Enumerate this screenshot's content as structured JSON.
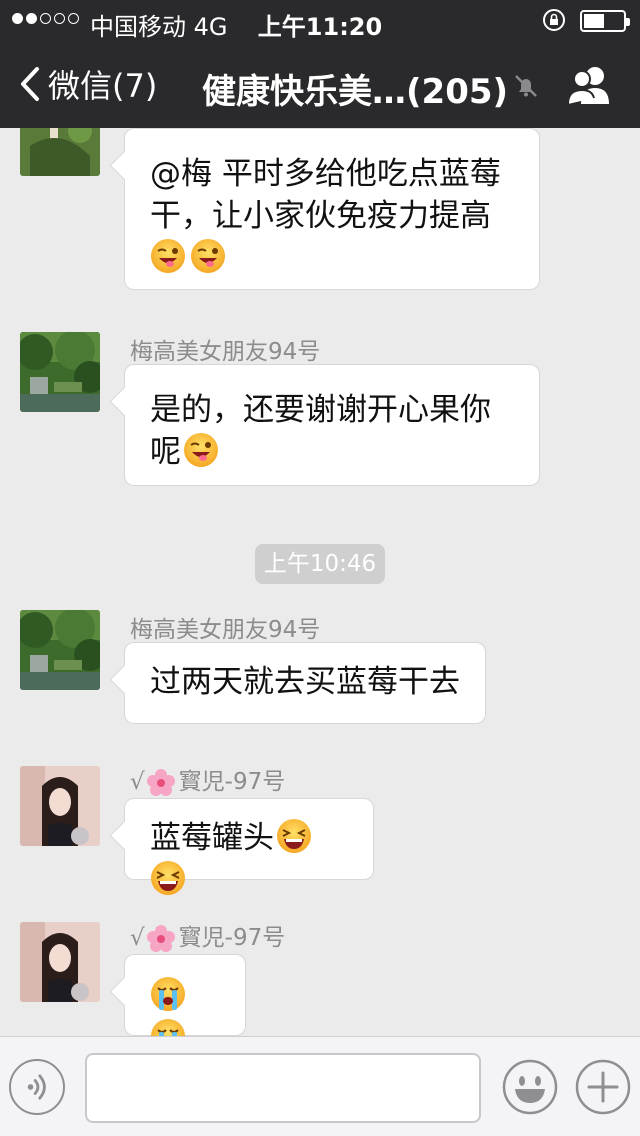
{
  "status_bar": {
    "carrier": "中国移动",
    "network": "4G",
    "time": "上午11:20",
    "signal_strength": 2,
    "battery_level": 0.45
  },
  "nav": {
    "back_label": "微信(7)",
    "title": "健康快乐美…(205)"
  },
  "messages": [
    {
      "sender": "",
      "text_lines": [
        "@梅 平时多给他吃点蓝莓",
        "干，让小家伙免疫力提高"
      ],
      "emoji_line": [
        "grin-wink-emoji",
        "grin-wink-emoji"
      ]
    },
    {
      "sender": "梅高美女朋友94号",
      "text_lines": [
        "是的，还要谢谢开心果你",
        "呢"
      ],
      "emoji_inline": "grin-wink-emoji"
    },
    {
      "timestamp": "上午10:46"
    },
    {
      "sender": "梅高美女朋友94号",
      "text_lines": [
        "过两天就去买蓝莓干去"
      ]
    },
    {
      "sender_prefix": "√",
      "sender": "寳児-97号",
      "text_lines": [
        "蓝莓罐头"
      ],
      "emoji_inline": [
        "laugh-cry-emoji",
        "laugh-cry-emoji"
      ]
    },
    {
      "sender_prefix": "√",
      "sender": "寳児-97号",
      "emoji_line": [
        "crying-emoji",
        "crying-emoji"
      ]
    }
  ],
  "input": {
    "placeholder": "",
    "value": ""
  },
  "colors": {
    "header_bg": "#2a2a2d",
    "chat_bg": "#ebebeb",
    "bubble_bg": "#ffffff",
    "timestamp_bg": "#cfcfcf"
  }
}
